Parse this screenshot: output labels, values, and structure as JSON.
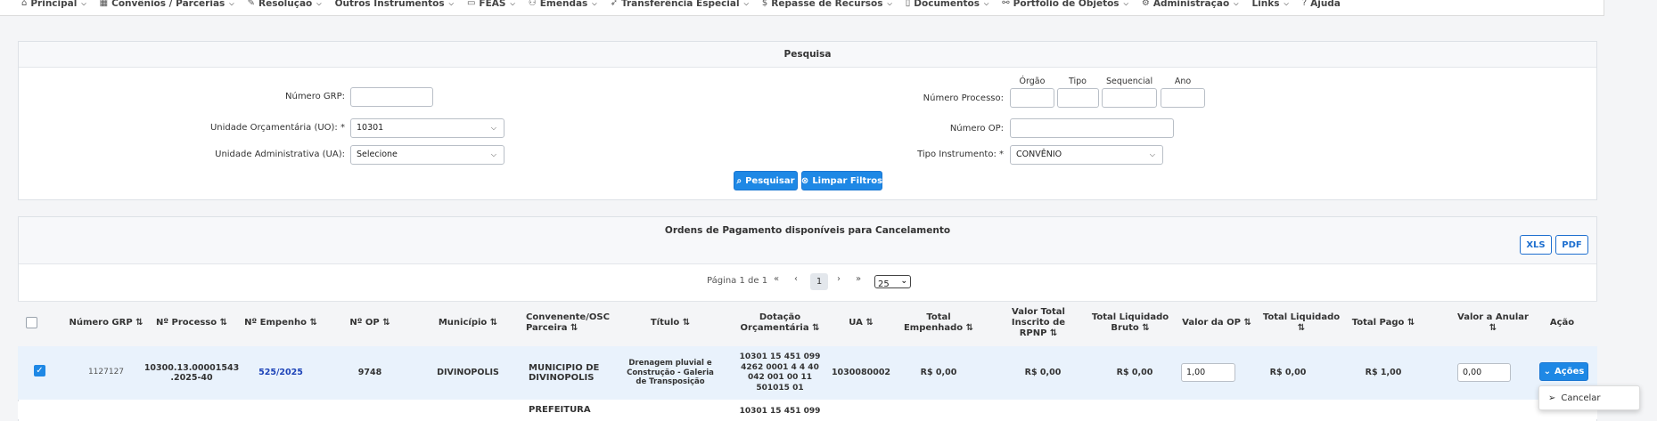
{
  "nav": [
    {
      "icon": "⌂",
      "label": "Principal"
    },
    {
      "icon": "▦",
      "label": "Convênios / Parcerias"
    },
    {
      "icon": "✎",
      "label": "Resolução"
    },
    {
      "icon": "",
      "label": "Outros Instrumentos"
    },
    {
      "icon": "▭",
      "label": "FEAS"
    },
    {
      "icon": "⚇",
      "label": "Emendas"
    },
    {
      "icon": "➶",
      "label": "Transferência Especial"
    },
    {
      "icon": "$",
      "label": "Repasse de Recursos"
    },
    {
      "icon": "▯",
      "label": "Documentos"
    },
    {
      "icon": "⚯",
      "label": "Portfólio de Objetos"
    },
    {
      "icon": "⚙",
      "label": "Administração"
    },
    {
      "icon": "",
      "label": "Links"
    },
    {
      "icon": "?",
      "label": "Ajuda"
    }
  ],
  "search": {
    "title": "Pesquisa",
    "numero_grp_label": "Número GRP:",
    "numero_grp_value": "",
    "uo_label": "Unidade Orçamentária (UO):",
    "uo_value": "10301",
    "ua_label": "Unidade Administrativa (UA):",
    "ua_value": "Selecione",
    "numero_processo_label": "Número Processo:",
    "orgao_label": "Órgão",
    "tipo_label": "Tipo",
    "sequencial_label": "Sequencial",
    "ano_label": "Ano",
    "numero_op_label": "Número OP:",
    "tipo_instrumento_label": "Tipo Instrumento:",
    "tipo_instrumento_value": "CONVÊNIO",
    "required_mark": "*",
    "pesquisar_label": "Pesquisar",
    "limpar_label": "Limpar Filtros"
  },
  "results": {
    "title": "Ordens de Pagamento disponíveis para Cancelamento",
    "xls_label": "XLS",
    "pdf_label": "PDF",
    "page_text": "Página 1 de 1",
    "first": "«",
    "prev": "‹",
    "current_page": "1",
    "next": "›",
    "last": "»",
    "page_size": "25"
  },
  "columns": [
    "Número GRP ⇅",
    "Nº Processo ⇅",
    "Nº Empenho ⇅",
    "Nº OP ⇅",
    "Município ⇅",
    "Convenente/OSC Parceira ⇅",
    "Título ⇅",
    "Dotação Orçamentária ⇅",
    "UA ⇅",
    "Total Empenhado ⇅",
    "Valor Total Inscrito de RPNP ⇅",
    "Total Liquidado Bruto ⇅",
    "Valor da OP ⇅",
    "Total Liquidado ⇅",
    "Total Pago ⇅",
    "Valor a Anular ⇅",
    "Ação"
  ],
  "rows": [
    {
      "grp": "1127127",
      "processo": "10300.13.00001543 .2025-40",
      "empenho": "525/2025",
      "op": "9748",
      "municipio": "DIVINOPOLIS",
      "convenente": "MUNICIPIO DE DIVINOPOLIS",
      "titulo": "Drenagem pluvial e Construção - Galeria de Transposição",
      "dotacao": "10301 15 451 099 4262 0001 4 4 40 042 001 00 11 501015 01",
      "ua": "1030080002",
      "total_empenhado": "R$ 0,00",
      "rpnp": "R$ 0,00",
      "liquidado_bruto": "R$ 0,00",
      "valor_op": "1,00",
      "total_liquidado": "R$ 0,00",
      "total_pago": "R$ 1,00",
      "valor_anular": "0,00",
      "acoes_label": "Ações"
    }
  ],
  "partial_row": {
    "convenente": "PREFEITURA",
    "dotacao": "10301 15 451 099"
  },
  "dropdown": {
    "cancelar_label": "Cancelar"
  },
  "colors": {
    "primary": "#1e88e5",
    "selected_row": "#e9f2fc"
  }
}
